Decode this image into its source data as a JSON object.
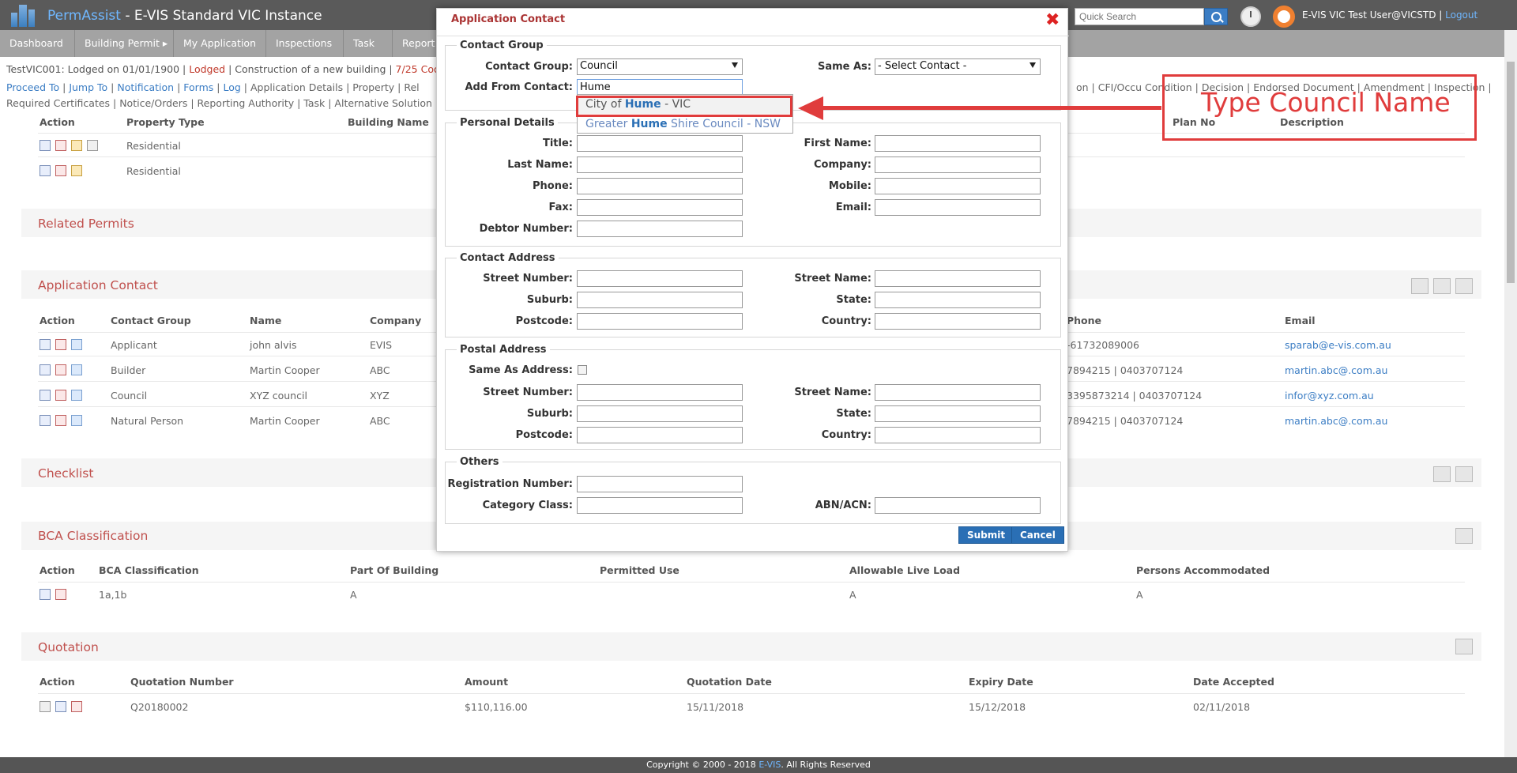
{
  "header": {
    "brand": "PermAssist",
    "instance": " - E-VIS Standard VIC Instance",
    "quick_search_placeholder": "Quick Search",
    "user": "E-VIS VIC Test User@VICSTD",
    "separator": " | ",
    "logout": "Logout"
  },
  "nav": [
    "Dashboard",
    "Building Permit ▸",
    "My Application",
    "Inspections",
    "Task",
    "Report"
  ],
  "info": {
    "line1_prefix": "TestVIC001: Lodged on 01/01/1900 | ",
    "status": "Lodged",
    "line1_mid": " | Construction of a new building | ",
    "progress": "7/25 Coo"
  },
  "links": {
    "row1_blue": [
      "Proceed To",
      "Jump To",
      "Notification",
      "Forms",
      "Log"
    ],
    "row1_gray": [
      "Application Details",
      "Property",
      "Rel"
    ],
    "row1_right": "on | CFI/Occu Condition | Decision | Endorsed Document | Amendment | Inspection |",
    "row2": "Required Certificates | Notice/Orders | Reporting Authority | Task | Alternative Solution"
  },
  "property": {
    "headers": [
      "Action",
      "Property Type",
      "Building Name",
      "Plan No",
      "Description"
    ],
    "rows": [
      "Residential",
      "Residential"
    ]
  },
  "related_permits": {
    "title": "Related Permits"
  },
  "application_contact": {
    "title": "Application Contact",
    "headers": [
      "Action",
      "Contact Group",
      "Name",
      "Company",
      "Phone",
      "Email"
    ],
    "rows": [
      {
        "group": "Applicant",
        "name": "john alvis",
        "company": "EVIS",
        "phone": "-61732089006",
        "email": "sparab@e-vis.com.au"
      },
      {
        "group": "Builder",
        "name": "Martin Cooper",
        "company": "ABC",
        "phone": "7894215 | 0403707124",
        "email": "martin.abc@.com.au"
      },
      {
        "group": "Council",
        "name": "XYZ council",
        "company": "XYZ",
        "phone": "3395873214 | 0403707124",
        "email": "infor@xyz.com.au"
      },
      {
        "group": "Natural Person",
        "name": "Martin Cooper",
        "company": "ABC",
        "phone": "7894215 | 0403707124",
        "email": "martin.abc@.com.au"
      }
    ]
  },
  "checklist": {
    "title": "Checklist"
  },
  "bca": {
    "title": "BCA Classification",
    "headers": [
      "Action",
      "BCA Classification",
      "Part Of Building",
      "Permitted Use",
      "Allowable Live Load",
      "Persons Accommodated"
    ],
    "row": [
      "1a,1b",
      "A",
      "A",
      "A"
    ]
  },
  "quotation": {
    "title": "Quotation",
    "headers": [
      "Action",
      "Quotation Number",
      "Amount",
      "Quotation Date",
      "Expiry Date",
      "Date Accepted"
    ],
    "row": [
      "Q20180002",
      "$110,116.00",
      "15/11/2018",
      "15/12/2018",
      "02/11/2018"
    ]
  },
  "modal": {
    "title": "Application Contact",
    "contact_group": {
      "legend": "Contact Group",
      "group_label": "Contact Group:",
      "group_value": "Council",
      "same_as_label": "Same As:",
      "same_as_value": "- Select Contact -",
      "add_from_label": "Add From Contact:",
      "add_from_value": "Hume"
    },
    "autocomplete": [
      {
        "pre": "City of ",
        "hl": "Hume",
        "post": " - VIC"
      },
      {
        "pre": "Greater ",
        "hl": "Hume",
        "post": " Shire Council - NSW"
      }
    ],
    "personal": {
      "legend": "Personal Details",
      "title": "Title:",
      "first_name": "First Name:",
      "last_name": "Last Name:",
      "company": "Company:",
      "phone": "Phone:",
      "mobile": "Mobile:",
      "fax": "Fax:",
      "email": "Email:",
      "debtor": "Debtor Number:"
    },
    "contact_address": {
      "legend": "Contact Address",
      "street_number": "Street Number:",
      "street_name": "Street Name:",
      "suburb": "Suburb:",
      "state": "State:",
      "postcode": "Postcode:",
      "country": "Country:"
    },
    "postal_address": {
      "legend": "Postal Address",
      "same_as": "Same As Address:",
      "street_number": "Street Number:",
      "street_name": "Street Name:",
      "suburb": "Suburb:",
      "state": "State:",
      "postcode": "Postcode:",
      "country": "Country:"
    },
    "others": {
      "legend": "Others",
      "registration": "Registration Number:",
      "category": "Category Class:",
      "abn": "ABN/ACN:"
    },
    "submit": "Submit",
    "cancel": "Cancel"
  },
  "annotation": {
    "text": "Type Council Name",
    "color": "#e03c3c"
  },
  "footer": {
    "prefix": "Copyright © 2000 - 2018 ",
    "brand": "E-VIS",
    "suffix": ". All Rights Reserved"
  }
}
